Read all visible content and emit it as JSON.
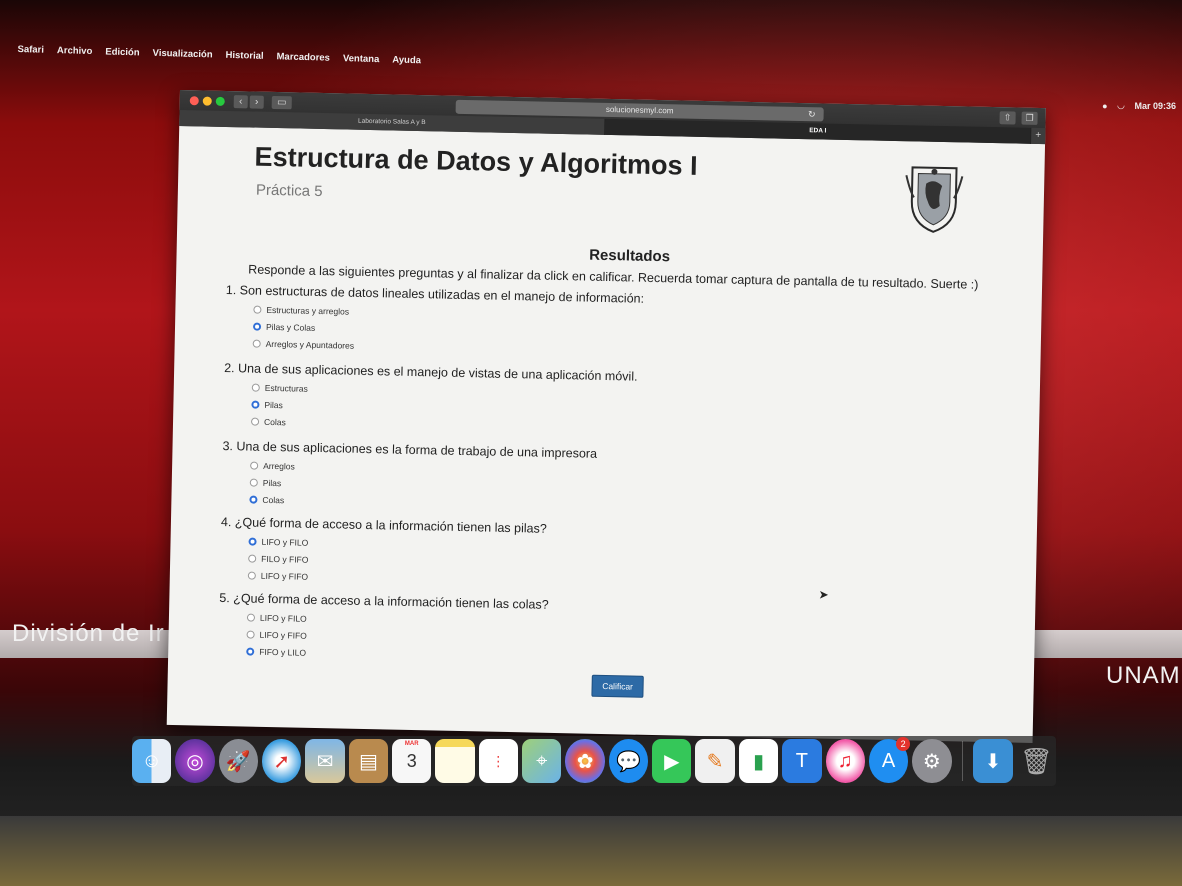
{
  "menubar": {
    "items": [
      "Safari",
      "Archivo",
      "Edición",
      "Visualización",
      "Historial",
      "Marcadores",
      "Ventana",
      "Ayuda"
    ],
    "clock": "Mar 09:36"
  },
  "browser": {
    "url": "solucionesmyl.com",
    "tabs": [
      "Laboratorio Salas A y B",
      "EDA I"
    ]
  },
  "page": {
    "title": "Estructura de Datos y Algoritmos I",
    "subtitle": "Práctica 5",
    "results_heading": "Resultados",
    "instructions": "Responde a las siguientes preguntas y al finalizar da click en calificar. Recuerda tomar captura de pantalla de tu resultado. Suerte :)",
    "questions": [
      {
        "text": "1. Son estructuras de datos lineales utilizadas en el manejo de información:",
        "options": [
          "Estructuras y arreglos",
          "Pilas y Colas",
          "Arreglos y Apuntadores"
        ],
        "selected": 1
      },
      {
        "text": "2. Una de sus aplicaciones es el manejo de vistas de una aplicación móvil.",
        "options": [
          "Estructuras",
          "Pilas",
          "Colas"
        ],
        "selected": 1
      },
      {
        "text": "3. Una de sus aplicaciones es la forma de trabajo de una impresora",
        "options": [
          "Arreglos",
          "Pilas",
          "Colas"
        ],
        "selected": 2
      },
      {
        "text": "4. ¿Qué forma de acceso a la información tienen las pilas?",
        "options": [
          "LIFO y FILO",
          "FILO y FIFO",
          "LIFO y FIFO"
        ],
        "selected": 0
      },
      {
        "text": "5. ¿Qué forma de acceso a la información tienen las colas?",
        "options": [
          "LIFO y FILO",
          "LIFO y FIFO",
          "FIFO y LILO"
        ],
        "selected": 2
      }
    ],
    "submit_label": "Calificar"
  },
  "desktop": {
    "left_text": "División de Ir",
    "right_text": "UNAM"
  },
  "dock": {
    "calendar_month": "MAR",
    "calendar_day": "3",
    "app_store_badge": "2",
    "apps": [
      "finder-icon",
      "siri-icon",
      "launchpad-icon",
      "safari-icon",
      "mail-icon",
      "contacts-icon",
      "calendar-icon",
      "notes-icon",
      "reminders-icon",
      "maps-icon",
      "photos-icon",
      "messages-icon",
      "facetime-icon",
      "keynote-icon",
      "numbers-icon",
      "keynote-podium-icon",
      "itunes-icon",
      "app-store-icon",
      "system-preferences-icon",
      "downloads-folder-icon",
      "trash-icon"
    ]
  },
  "colors": {
    "accent": "#2f6ed6",
    "submit": "#2d6aa6",
    "wallpaper": "#b1151a"
  }
}
